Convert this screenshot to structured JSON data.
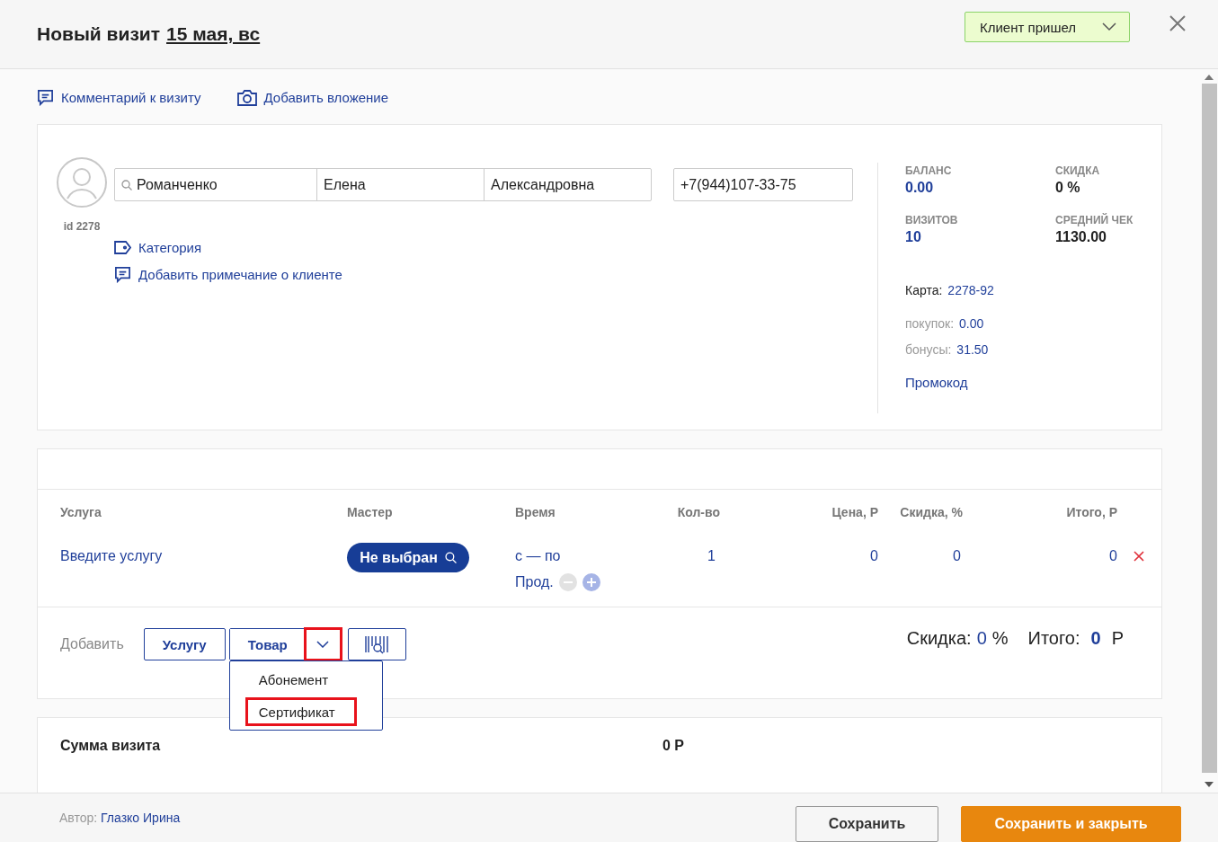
{
  "header": {
    "title": "Новый визит",
    "date": "15 мая, вс",
    "status": "Клиент пришел"
  },
  "actions": [
    "Комментарий к визиту",
    "Добавить вложение"
  ],
  "client": {
    "last_name": "Романченко",
    "first_name": "Елена",
    "middle_name": "Александровна",
    "phone": "+7(944)107-33-75",
    "id": "id 2278",
    "links": [
      "Категория",
      "Добавить примечание о клиенте"
    ]
  },
  "stats": [
    {
      "label": "БАЛАНС",
      "value": "0.00",
      "accent": true
    },
    {
      "label": "СКИДКА",
      "value": "0 %",
      "accent": false
    },
    {
      "label": "ВИЗИТОВ",
      "value": "10",
      "accent": true
    },
    {
      "label": "СРЕДНИЙ ЧЕК",
      "value": "1130.00",
      "accent": false
    }
  ],
  "card": {
    "label": "Карта:",
    "number": "2278-92",
    "details": [
      {
        "label": "покупок:",
        "value": "0.00"
      },
      {
        "label": "бонусы:",
        "value": "31.50"
      }
    ],
    "promo": "Промокод"
  },
  "table": {
    "columns": [
      "Услуга",
      "Мастер",
      "Время",
      "Кол-во",
      "Цена, Р",
      "Скидка, %",
      "Итого, Р"
    ],
    "rows": [
      {
        "service": "Введите услугу",
        "master": "Не выбран",
        "time": "с — по",
        "extend": "Прод.",
        "qty": "1",
        "price": "0",
        "discount": "0",
        "total": "0"
      }
    ]
  },
  "add": {
    "label": "Добавить",
    "buttons": [
      "Услугу",
      "Товар"
    ],
    "menu_open": true,
    "chevron_highlighted": true,
    "menu": [
      {
        "label": "Абонемент",
        "highlighted": false
      },
      {
        "label": "Сертификат",
        "highlighted": true
      }
    ]
  },
  "totals": {
    "discount_label": "Скидка:",
    "discount_value": "0",
    "discount_unit": "%",
    "total_label": "Итого:",
    "total_value": "0",
    "total_unit": "Р"
  },
  "summary": {
    "label": "Сумма визита",
    "value": "0 Р"
  },
  "footer": {
    "author_label": "Автор:",
    "author": "Глазко Ирина",
    "buttons": [
      {
        "label": "Сохранить",
        "kind": "secondary"
      },
      {
        "label": "Сохранить и закрыть",
        "kind": "primary"
      }
    ]
  }
}
